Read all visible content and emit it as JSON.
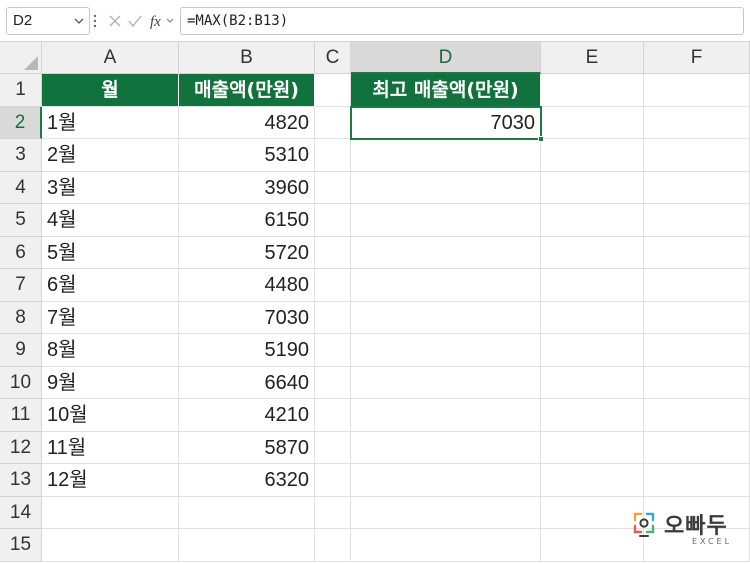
{
  "formula_bar": {
    "name_box": "D2",
    "formula": "=MAX(B2:B13)",
    "fx_label": "fx"
  },
  "columns": [
    "A",
    "B",
    "C",
    "D",
    "E",
    "F"
  ],
  "rows": [
    "1",
    "2",
    "3",
    "4",
    "5",
    "6",
    "7",
    "8",
    "9",
    "10",
    "11",
    "12",
    "13",
    "14",
    "15"
  ],
  "table": {
    "header_month": "월",
    "header_sales": "매출액(만원)",
    "months": [
      "1월",
      "2월",
      "3월",
      "4월",
      "5월",
      "6월",
      "7월",
      "8월",
      "9월",
      "10월",
      "11월",
      "12월"
    ],
    "sales": [
      "4820",
      "5310",
      "3960",
      "6150",
      "5720",
      "4480",
      "7030",
      "5190",
      "6640",
      "4210",
      "5870",
      "6320"
    ]
  },
  "result": {
    "header": "최고 매출액(만원)",
    "value": "7030"
  },
  "colors": {
    "header_fill": "#12723d",
    "selection": "#1d7a44"
  },
  "logo": {
    "name": "오빠두",
    "sub": "EXCEL"
  }
}
